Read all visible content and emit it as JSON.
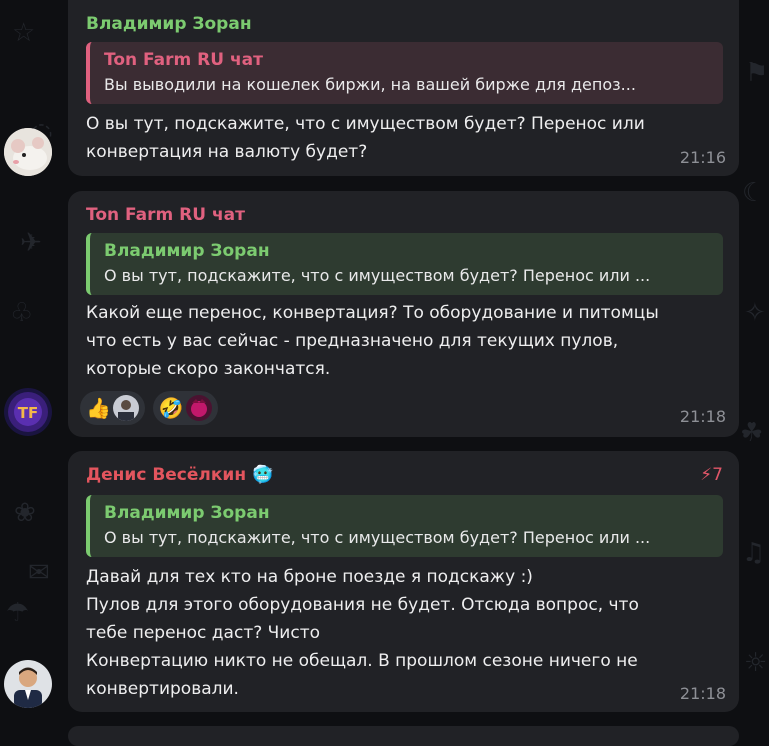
{
  "colors": {
    "bubble": "#212226",
    "green_name": "#7ccb70",
    "pink_name": "#e0617f",
    "red_name": "#e3555e",
    "time": "#8e9096"
  },
  "messages": [
    {
      "sender": "Владимир Зоран",
      "reply": {
        "author": "Ton Farm RU чат",
        "text": "Вы выводили на кошелек биржи, на вашей бирже для депоз..."
      },
      "lines": [
        "О вы тут, подскажите, что с имуществом будет? Перенос или",
        "конвертация на валюту будет?"
      ],
      "time": "21:16",
      "avatar_icon": "rat-avatar-icon"
    },
    {
      "sender": "Ton Farm RU чат",
      "reply": {
        "author": "Владимир Зоран",
        "text": "О вы тут, подскажите, что с имуществом будет? Перенос или ..."
      },
      "lines": [
        "Какой еще перенос, конвертация? То оборудование и питомцы",
        "что есть у вас сейчас - предназначено для текущих пулов,",
        "которые скоро закончатся."
      ],
      "reactions": [
        {
          "emoji": "👍",
          "users": [
            "user-avatar"
          ]
        },
        {
          "emoji": "🤣",
          "users": [
            "user-avatar"
          ]
        }
      ],
      "time": "21:18",
      "avatar_icon": "tf-logo-avatar-icon"
    },
    {
      "sender": "Денис Весёлкин",
      "sender_badge": "🥶",
      "boost": "7",
      "reply": {
        "author": "Владимир Зоран",
        "text": "О вы тут, подскажите, что с имуществом будет? Перенос или ..."
      },
      "lines": [
        "Давай для тех кто на броне поезде я подскажу :)",
        "Пулов для этого оборудования не будет. Отсюда вопрос, что",
        "тебе перенос даст? Чисто",
        "Конвертацию никто не обещал. В прошлом сезоне ничего не",
        "конвертировали."
      ],
      "time": "21:18",
      "avatar_icon": "man-avatar-icon"
    }
  ]
}
